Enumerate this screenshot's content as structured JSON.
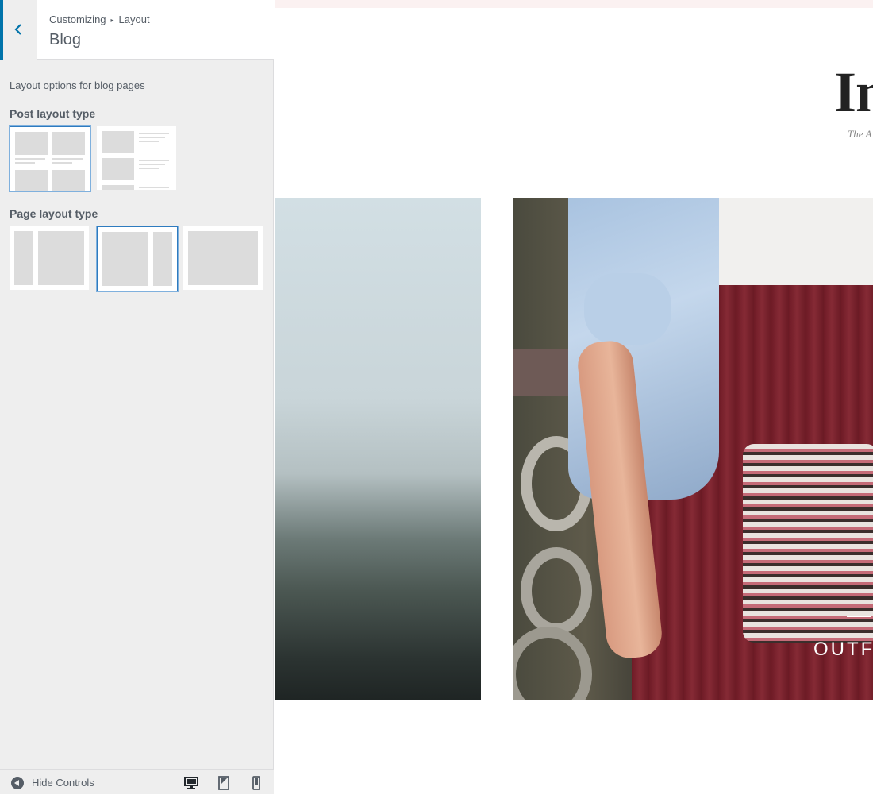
{
  "sidebar": {
    "breadcrumb": {
      "parent": "Customizing",
      "separator": "▸",
      "current": "Layout"
    },
    "section_title": "Blog",
    "description": "Layout options for blog pages",
    "post_layout": {
      "label": "Post layout type",
      "options": [
        "grid",
        "list"
      ],
      "selected": "grid"
    },
    "page_layout": {
      "label": "Page layout type",
      "options": [
        "left-sidebar",
        "right-sidebar",
        "no-sidebar"
      ],
      "selected": "right-sidebar"
    },
    "footer": {
      "hide_controls_label": "Hide Controls",
      "devices": [
        "desktop",
        "tablet",
        "mobile"
      ],
      "active_device": "desktop"
    }
  },
  "preview": {
    "site_title_partial": "In",
    "tagline_partial": "The A",
    "featured_post_title_partial": "OUTF"
  },
  "colors": {
    "accent": "#0073aa",
    "selected_border": "#2e7bbf",
    "skirt": "#7a1f2b"
  }
}
